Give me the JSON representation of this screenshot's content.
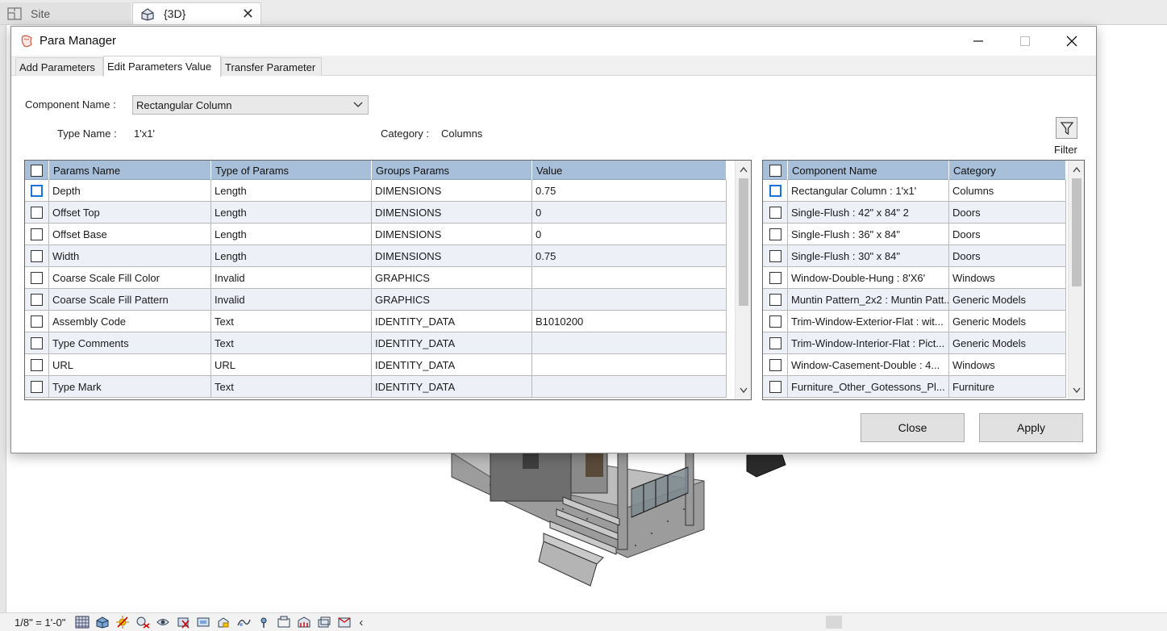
{
  "app": {
    "tabs": [
      {
        "label": "Site",
        "icon": "floor-plan-icon"
      },
      {
        "label": "{3D}",
        "icon": "house-3d-icon"
      }
    ],
    "status": {
      "scale": "1/8\" = 1'-0\""
    }
  },
  "dialog": {
    "title": "Para Manager",
    "tabs": [
      "Add Parameters",
      "Edit Parameters Value",
      "Transfer Parameter"
    ],
    "active_tab": "Edit Parameters Value",
    "component_name_label": "Component Name :",
    "component_name_value": "Rectangular Column",
    "type_name_label": "Type Name :",
    "type_name_value": "1'x1'",
    "category_label": "Category :",
    "category_value": "Columns",
    "filter_label": "Filter",
    "params_table": {
      "headers": [
        "Params Name",
        "Type of Params",
        "Groups Params",
        "Value"
      ],
      "rows": [
        [
          "Depth",
          "Length",
          "DIMENSIONS",
          "0.75"
        ],
        [
          "Offset Top",
          "Length",
          "DIMENSIONS",
          "0"
        ],
        [
          "Offset Base",
          "Length",
          "DIMENSIONS",
          "0"
        ],
        [
          "Width",
          "Length",
          "DIMENSIONS",
          "0.75"
        ],
        [
          "Coarse Scale Fill Color",
          "Invalid",
          "GRAPHICS",
          ""
        ],
        [
          "Coarse Scale Fill Pattern",
          "Invalid",
          "GRAPHICS",
          ""
        ],
        [
          "Assembly Code",
          "Text",
          "IDENTITY_DATA",
          "B1010200"
        ],
        [
          "Type Comments",
          "Text",
          "IDENTITY_DATA",
          ""
        ],
        [
          "URL",
          "URL",
          "IDENTITY_DATA",
          ""
        ],
        [
          "Type Mark",
          "Text",
          "IDENTITY_DATA",
          ""
        ]
      ]
    },
    "components_table": {
      "headers": [
        "Component Name",
        "Category"
      ],
      "rows": [
        [
          "Rectangular Column : 1'x1'",
          "Columns"
        ],
        [
          "Single-Flush : 42\" x 84\" 2",
          "Doors"
        ],
        [
          "Single-Flush : 36\" x 84\"",
          "Doors"
        ],
        [
          "Single-Flush : 30\" x 84\"",
          "Doors"
        ],
        [
          "Window-Double-Hung : 8'X6'",
          "Windows"
        ],
        [
          "Muntin Pattern_2x2 : Muntin Patt...",
          "Generic Models"
        ],
        [
          "Trim-Window-Exterior-Flat : wit...",
          "Generic Models"
        ],
        [
          "Trim-Window-Interior-Flat : Pict...",
          "Generic Models"
        ],
        [
          "Window-Casement-Double : 4...",
          "Windows"
        ],
        [
          "Furniture_Other_Gotessons_Pl...",
          "Furniture"
        ]
      ]
    },
    "buttons": {
      "close": "Close",
      "apply": "Apply"
    }
  },
  "colors": {
    "header_bg": "#a8bfd9",
    "alt_row_bg": "#eef0f8",
    "focus_blue": "#1a73d9"
  }
}
